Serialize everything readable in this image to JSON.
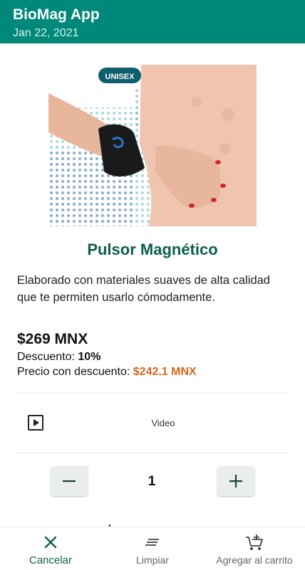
{
  "appbar": {
    "title": "BioMag App",
    "date": "Jan 22, 2021"
  },
  "product": {
    "badge": "UNISEX",
    "brand_mark": "BioMag",
    "title": "Pulsor Magnético",
    "description": "Elaborado con materiales suaves de alta calidad que te permiten usarlo cómodamente.",
    "price": "$269 MNX",
    "discount_label": "Descuento: ",
    "discount_value": "10%",
    "final_label": "Precio con descuento: ",
    "final_value": "$242.1 MNX"
  },
  "video": {
    "label": "Video",
    "icon": "play-box-icon"
  },
  "stepper": {
    "quantity": "1",
    "minus_icon": "minus-icon",
    "plus_icon": "plus-icon"
  },
  "bottom_nav": {
    "items": [
      {
        "label": "Cancelar",
        "icon": "close-icon",
        "active": true
      },
      {
        "label": "Limpiar",
        "icon": "clear-all-icon",
        "active": false
      },
      {
        "label": "Agregar al carrito",
        "icon": "add-to-cart-icon",
        "active": false
      }
    ]
  },
  "colors": {
    "primary": "#00897b",
    "title": "#0f5e4e",
    "accent": "#d9651a",
    "dots_teal": "#8ed3cc",
    "dots_blue": "#8aa3c9",
    "skin": "#f0c5b0"
  }
}
